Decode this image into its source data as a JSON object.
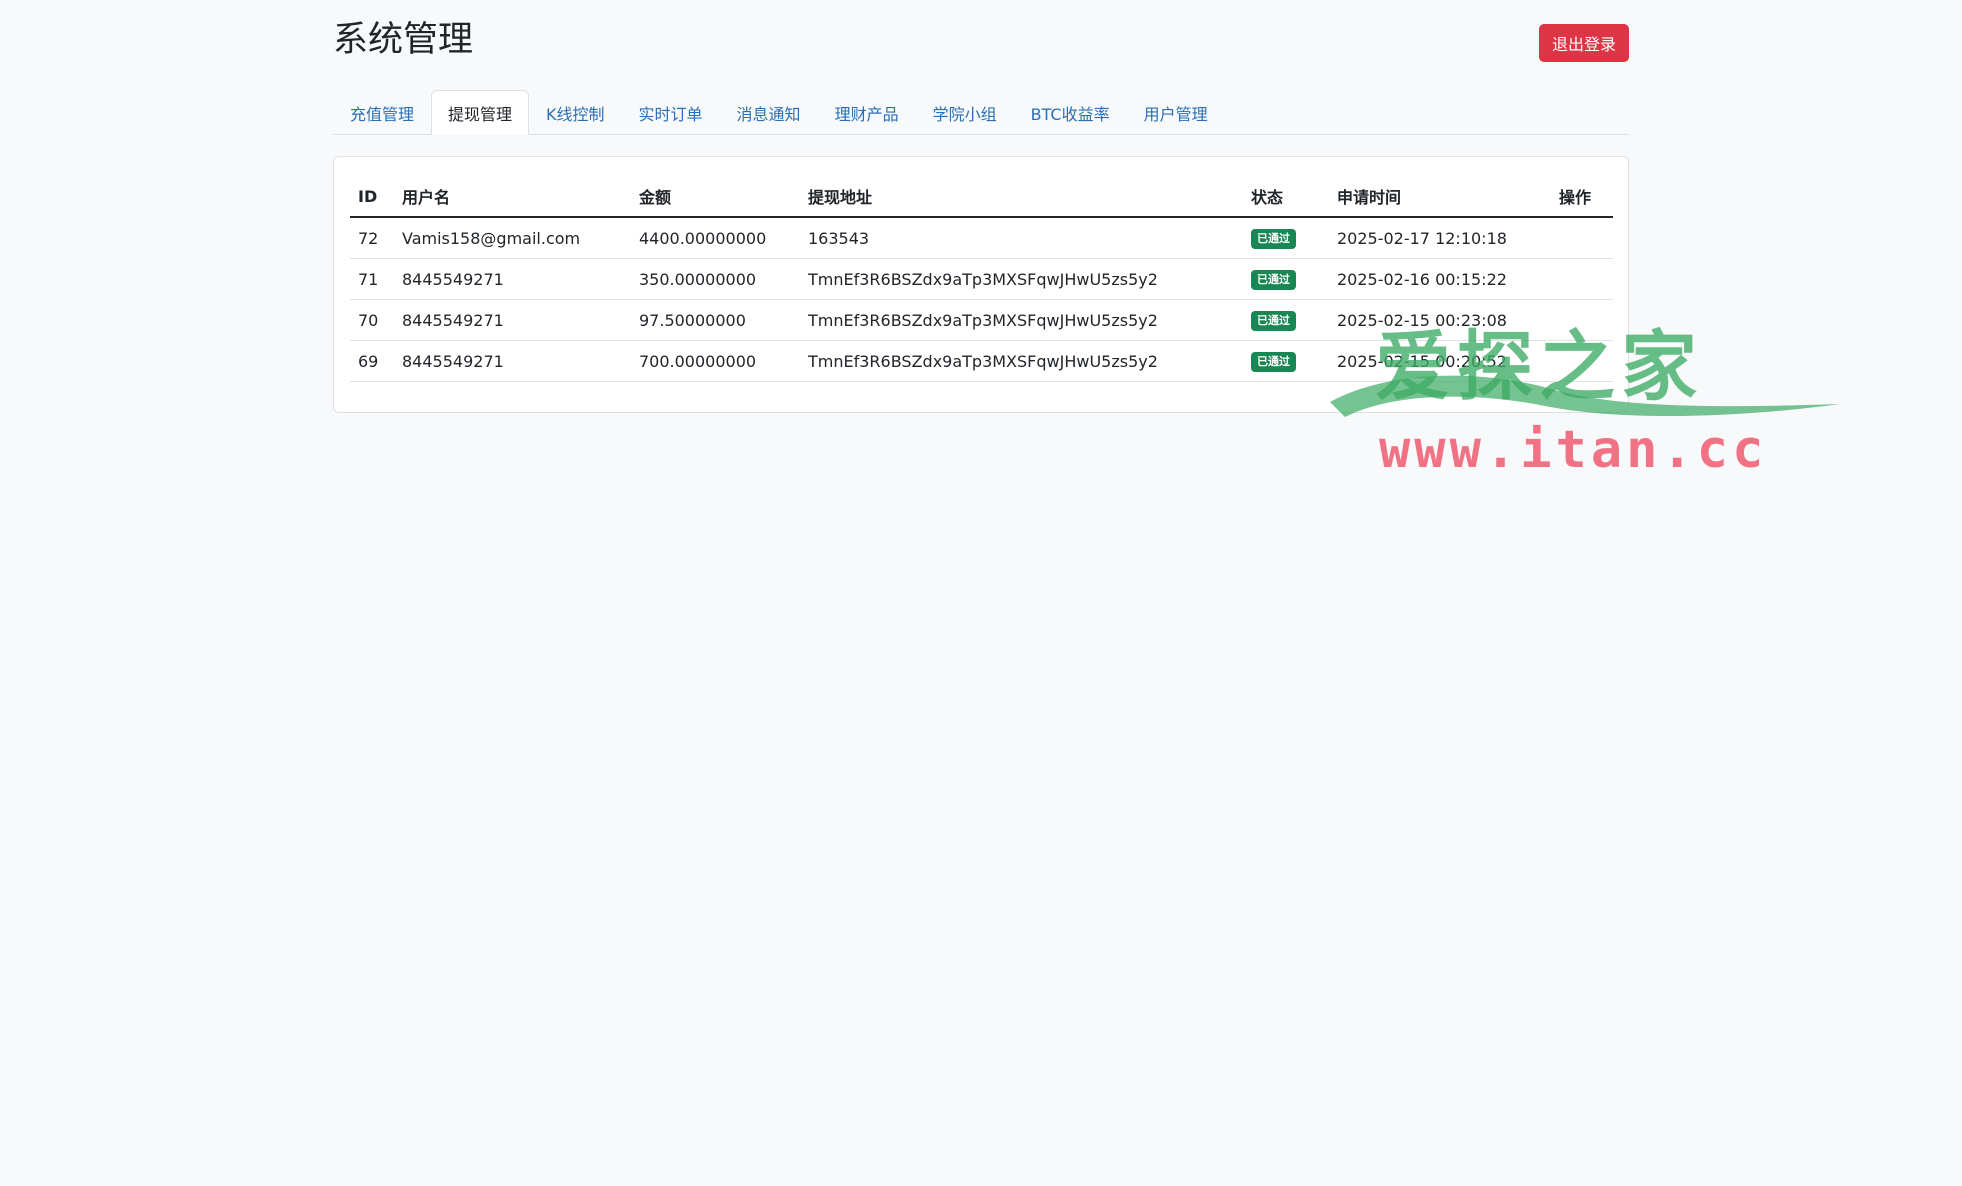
{
  "header": {
    "title": "系统管理",
    "logout_label": "退出登录"
  },
  "tabs": [
    {
      "label": "充值管理",
      "active": false
    },
    {
      "label": "提现管理",
      "active": true
    },
    {
      "label": "K线控制",
      "active": false
    },
    {
      "label": "实时订单",
      "active": false
    },
    {
      "label": "消息通知",
      "active": false
    },
    {
      "label": "理财产品",
      "active": false
    },
    {
      "label": "学院小组",
      "active": false
    },
    {
      "label": "BTC收益率",
      "active": false
    },
    {
      "label": "用户管理",
      "active": false
    }
  ],
  "table": {
    "columns": [
      "ID",
      "用户名",
      "金额",
      "提现地址",
      "状态",
      "申请时间",
      "操作"
    ],
    "rows": [
      {
        "id": "72",
        "username": "Vamis158@gmail.com",
        "amount": "4400.00000000",
        "address": "163543",
        "status": "已通过",
        "time": "2025-02-17 12:10:18",
        "action": ""
      },
      {
        "id": "71",
        "username": "8445549271",
        "amount": "350.00000000",
        "address": "TmnEf3R6BSZdx9aTp3MXSFqwJHwU5zs5y2",
        "status": "已通过",
        "time": "2025-02-16 00:15:22",
        "action": ""
      },
      {
        "id": "70",
        "username": "8445549271",
        "amount": "97.50000000",
        "address": "TmnEf3R6BSZdx9aTp3MXSFqwJHwU5zs5y2",
        "status": "已通过",
        "time": "2025-02-15 00:23:08",
        "action": ""
      },
      {
        "id": "69",
        "username": "8445549271",
        "amount": "700.00000000",
        "address": "TmnEf3R6BSZdx9aTp3MXSFqwJHwU5zs5y2",
        "status": "已通过",
        "time": "2025-02-15 00:20:52",
        "action": ""
      }
    ]
  },
  "watermark": {
    "brand": "爱探之家",
    "url": "www.itan.cc"
  },
  "colors": {
    "page_bg": "#f8f9fa",
    "danger": "#dc3545",
    "link": "#2a6fb5",
    "success": "#198754"
  }
}
